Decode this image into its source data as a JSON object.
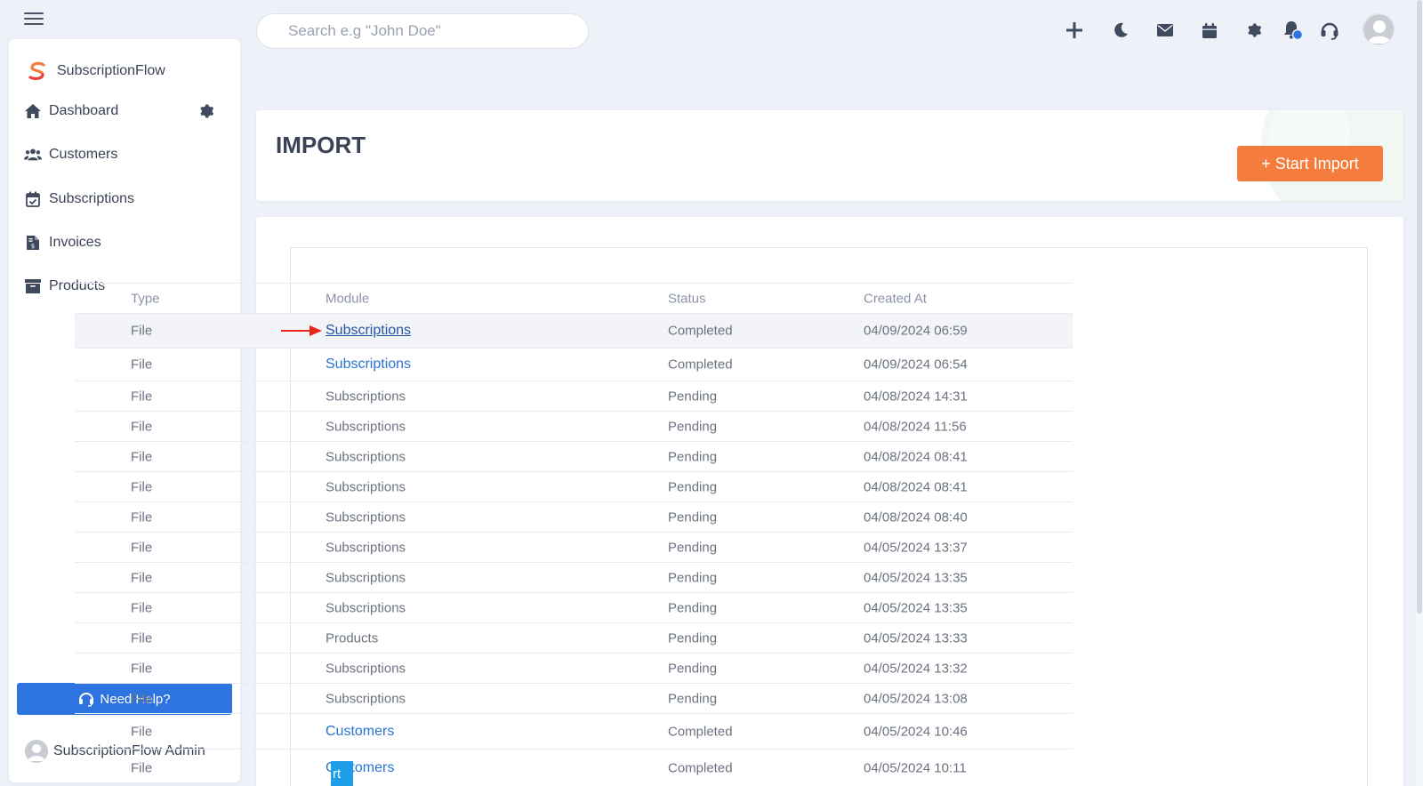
{
  "app": {
    "brand_name": "SubscriptionFlow",
    "brand_colors": {
      "primary": "#f47c3c",
      "accent": "#2d74e0"
    }
  },
  "topbar": {
    "search_placeholder": "Search e.g \"John Doe\"",
    "icons": [
      "plus-icon",
      "moon-icon",
      "mail-icon",
      "calendar-icon",
      "gear-icon",
      "bell-icon",
      "headset-icon",
      "avatar"
    ]
  },
  "sidebar": {
    "items": [
      {
        "label": "Dashboard",
        "icon": "home-icon"
      },
      {
        "label": "Customers",
        "icon": "users-icon"
      },
      {
        "label": "Subscriptions",
        "icon": "calendar-check-icon"
      },
      {
        "label": "Invoices",
        "icon": "invoice-icon"
      },
      {
        "label": "Products",
        "icon": "archive-icon"
      }
    ],
    "help_label": "Need Help?",
    "admin_name": "SubscriptionFlow Admin"
  },
  "page": {
    "title": "IMPORT",
    "start_import_label": "+ Start Import"
  },
  "table": {
    "columns": [
      "Type",
      "Module",
      "Status",
      "Created At"
    ],
    "rows": [
      {
        "type": "File",
        "module": "Subscriptions",
        "status": "Completed",
        "created": "04/09/2024 06:59"
      },
      {
        "type": "File",
        "module": "Subscriptions",
        "status": "Completed",
        "created": "04/09/2024 06:54"
      },
      {
        "type": "File",
        "module": "Subscriptions",
        "status": "Pending",
        "created": "04/08/2024 14:31"
      },
      {
        "type": "File",
        "module": "Subscriptions",
        "status": "Pending",
        "created": "04/08/2024 11:56"
      },
      {
        "type": "File",
        "module": "Subscriptions",
        "status": "Pending",
        "created": "04/08/2024 08:41"
      },
      {
        "type": "File",
        "module": "Subscriptions",
        "status": "Pending",
        "created": "04/08/2024 08:41"
      },
      {
        "type": "File",
        "module": "Subscriptions",
        "status": "Pending",
        "created": "04/08/2024 08:40"
      },
      {
        "type": "File",
        "module": "Subscriptions",
        "status": "Pending",
        "created": "04/05/2024 13:37"
      },
      {
        "type": "File",
        "module": "Subscriptions",
        "status": "Pending",
        "created": "04/05/2024 13:35"
      },
      {
        "type": "File",
        "module": "Subscriptions",
        "status": "Pending",
        "created": "04/05/2024 13:35"
      },
      {
        "type": "File",
        "module": "Products",
        "status": "Pending",
        "created": "04/05/2024 13:33"
      },
      {
        "type": "File",
        "module": "Subscriptions",
        "status": "Pending",
        "created": "04/05/2024 13:32"
      },
      {
        "type": "File",
        "module": "Subscriptions",
        "status": "Pending",
        "created": "04/05/2024 13:08"
      },
      {
        "type": "File",
        "module": "Customers",
        "status": "Completed",
        "created": "04/05/2024 10:46"
      },
      {
        "type": "File",
        "module": "Customers",
        "status": "Completed",
        "created": "04/05/2024 10:11"
      }
    ]
  },
  "floating_tab_label": "rt"
}
